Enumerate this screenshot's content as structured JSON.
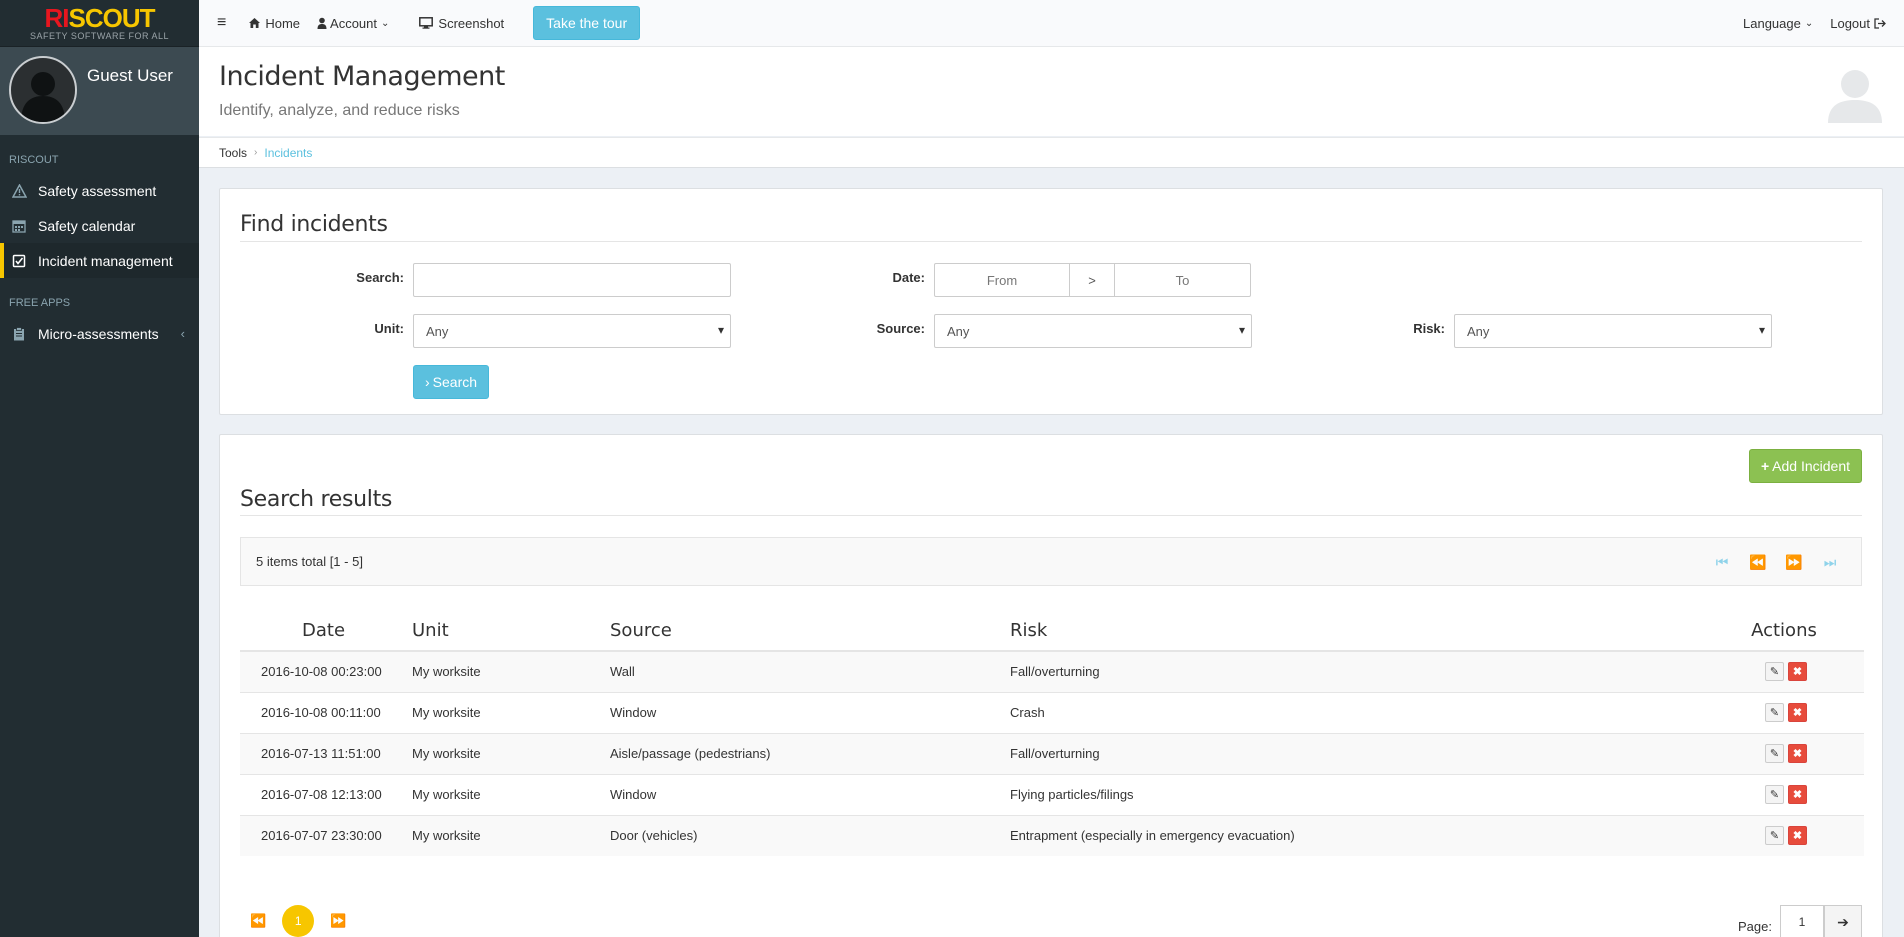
{
  "brand": {
    "logo_ri": "RI",
    "logo_scout": "SCOUT",
    "tagline": "SAFETY SOFTWARE FOR ALL"
  },
  "user": {
    "name": "Guest User"
  },
  "sidebar": {
    "section1": "RISCOUT",
    "items": [
      {
        "label": "Safety assessment",
        "icon": "warning-icon"
      },
      {
        "label": "Safety calendar",
        "icon": "calendar-icon"
      },
      {
        "label": "Incident management",
        "icon": "checklist-icon"
      }
    ],
    "section2": "FREE APPS",
    "items2": [
      {
        "label": "Micro-assessments",
        "icon": "clipboard-icon"
      }
    ]
  },
  "topnav": {
    "home": "Home",
    "account": "Account",
    "screenshot": "Screenshot",
    "tour": "Take the tour",
    "language": "Language",
    "logout": "Logout"
  },
  "header": {
    "title": "Incident Management",
    "subtitle": "Identify, analyze, and reduce risks"
  },
  "breadcrumb": {
    "root": "Tools",
    "current": "Incidents"
  },
  "find": {
    "title": "Find incidents",
    "search_label": "Search:",
    "date_label": "Date:",
    "date_from": "From",
    "date_sep": ">",
    "date_to": "To",
    "unit_label": "Unit:",
    "unit_value": "Any",
    "source_label": "Source:",
    "source_value": "Any",
    "risk_label": "Risk:",
    "risk_value": "Any",
    "search_button": "Search"
  },
  "results": {
    "title": "Search results",
    "add_button": "Add Incident",
    "summary": "5 items total [1 - 5]",
    "columns": [
      "Date",
      "Unit",
      "Source",
      "Risk",
      "Actions"
    ],
    "rows": [
      {
        "date": "2016-10-08 00:23:00",
        "unit": "My worksite",
        "source": "Wall",
        "risk": "Fall/overturning"
      },
      {
        "date": "2016-10-08 00:11:00",
        "unit": "My worksite",
        "source": "Window",
        "risk": "Crash"
      },
      {
        "date": "2016-07-13 11:51:00",
        "unit": "My worksite",
        "source": "Aisle/passage (pedestrians)",
        "risk": "Fall/overturning"
      },
      {
        "date": "2016-07-08 12:13:00",
        "unit": "My worksite",
        "source": "Window",
        "risk": "Flying particles/filings"
      },
      {
        "date": "2016-07-07 23:30:00",
        "unit": "My worksite",
        "source": "Door (vehicles)",
        "risk": "Entrapment (especially in emergency evacuation)"
      }
    ],
    "current_page": "1",
    "page_label": "Page:",
    "page_input": "1"
  },
  "colors": {
    "accent": "#5bc0de",
    "brand_yellow": "#f7c600",
    "brand_red": "#e8161f",
    "sidebar_bg": "#222d32",
    "add_green": "#8cc152",
    "delete_red": "#e74c3c"
  }
}
